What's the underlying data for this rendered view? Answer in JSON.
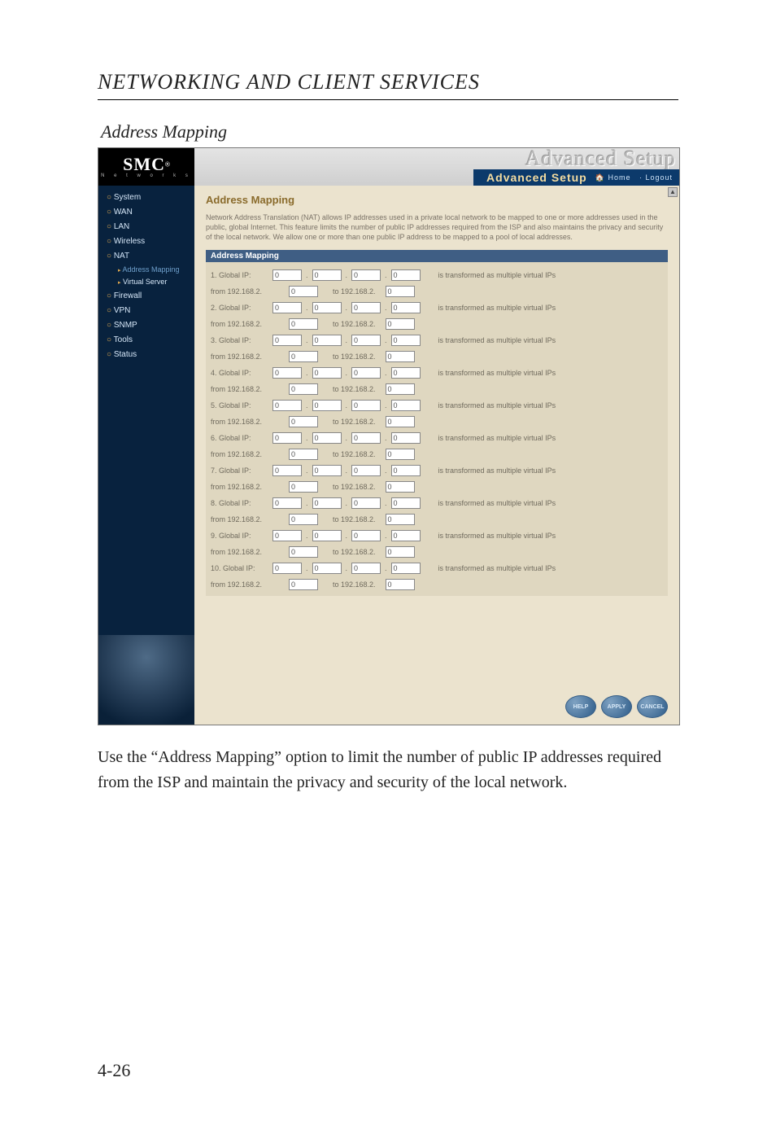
{
  "document": {
    "heading": "NETWORKING AND CLIENT SERVICES",
    "subheading": "Address Mapping",
    "paragraph": "Use the “Address Mapping” option to limit the number of public IP addresses required from the ISP and maintain the privacy and security of the local network.",
    "page_number": "4-26"
  },
  "ui": {
    "logo": "SMC",
    "logo_reg": "®",
    "logo_sub": "N e t w o r k s",
    "banner_ghost": "Advanced Setup",
    "banner_title": "Advanced Setup",
    "home_link": "🏠 Home",
    "logout_link": "· Logout",
    "sidebar": {
      "items": [
        {
          "label": "System",
          "data_name": "sidebar-item-system"
        },
        {
          "label": "WAN",
          "data_name": "sidebar-item-wan"
        },
        {
          "label": "LAN",
          "data_name": "sidebar-item-lan"
        },
        {
          "label": "Wireless",
          "data_name": "sidebar-item-wireless"
        },
        {
          "label": "NAT",
          "data_name": "sidebar-item-nat",
          "expanded": true,
          "children": [
            {
              "label": "Address Mapping",
              "data_name": "sidebar-item-address-mapping",
              "active": true
            },
            {
              "label": "Virtual Server",
              "data_name": "sidebar-item-virtual-server"
            }
          ]
        },
        {
          "label": "Firewall",
          "data_name": "sidebar-item-firewall"
        },
        {
          "label": "VPN",
          "data_name": "sidebar-item-vpn"
        },
        {
          "label": "SNMP",
          "data_name": "sidebar-item-snmp"
        },
        {
          "label": "Tools",
          "data_name": "sidebar-item-tools"
        },
        {
          "label": "Status",
          "data_name": "sidebar-item-status"
        }
      ]
    },
    "content": {
      "title": "Address Mapping",
      "intro": "Network Address Translation (NAT) allows IP addresses used in a private local network to be mapped to one or more addresses used in the public, global Internet. This feature limits the number of public IP addresses required from the ISP and also maintains the privacy and security of the local network. We allow one or more than one public IP address to be mapped to a pool of local addresses.",
      "table_header": "Address Mapping",
      "row_label_suffix": "is transformed as multiple virtual IPs",
      "range_prefix": "from  192.168.2.",
      "range_mid": "to 192.168.2.",
      "default_val": "0",
      "row_count": 10,
      "buttons": {
        "help": "HELP",
        "apply": "APPLY",
        "cancel": "CANCEL"
      }
    }
  }
}
